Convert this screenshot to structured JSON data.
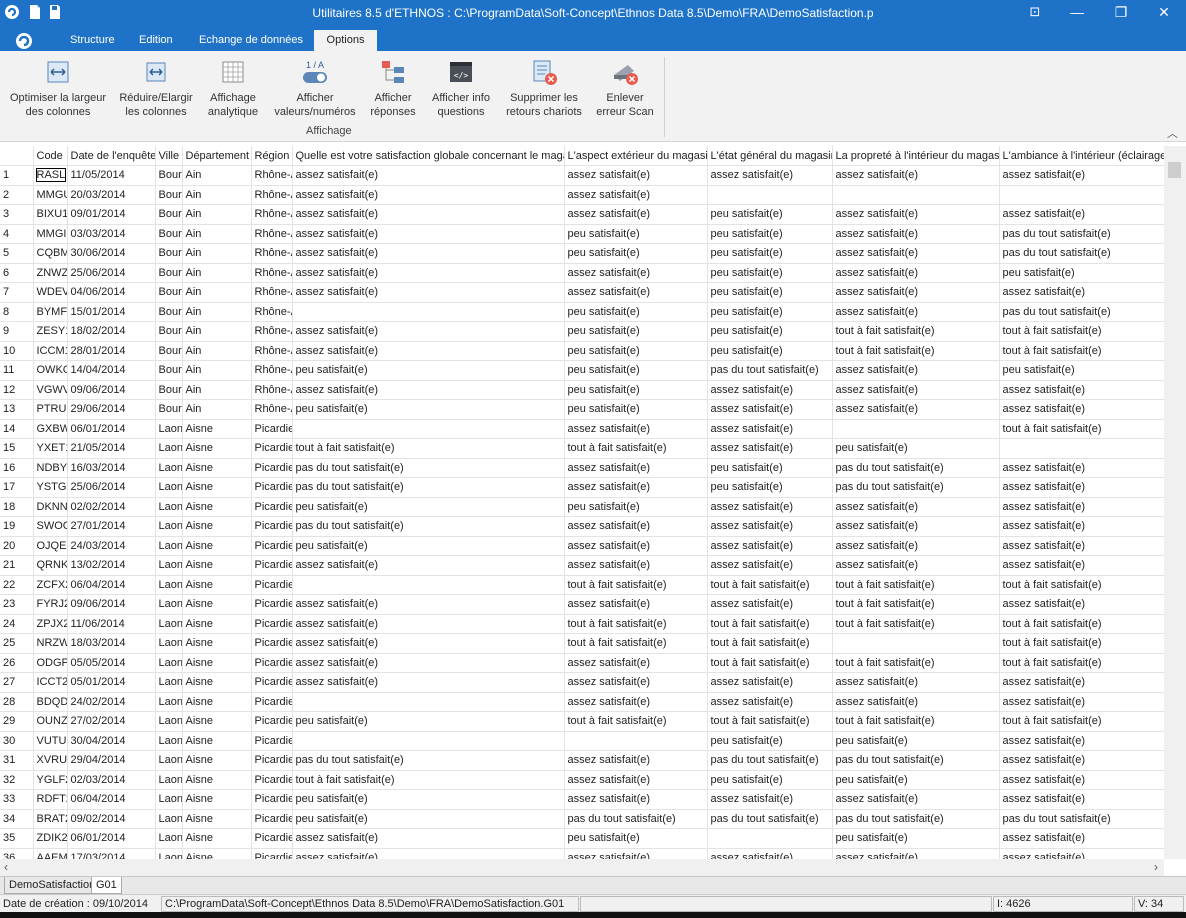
{
  "window": {
    "title": "Utilitaires 8.5 d'ETHNOS : C:\\ProgramData\\Soft-Concept\\Ethnos Data 8.5\\Demo\\FRA\\DemoSatisfaction.p",
    "min": "—",
    "restore": "❐",
    "close": "✕",
    "pin": "⊡"
  },
  "tabs": [
    "Structure",
    "Edition",
    "Echange de données",
    "Options"
  ],
  "ribbon": {
    "buttons": [
      {
        "line1": "Optimiser la largeur",
        "line2": "des colonnes",
        "icon": "fit-width-icon"
      },
      {
        "line1": "Réduire/Elargir",
        "line2": "les colonnes",
        "icon": "resize-columns-icon"
      },
      {
        "line1": "Affichage",
        "line2": "analytique",
        "icon": "grid-icon"
      },
      {
        "line1": "Afficher",
        "line2": "valeurs/numéros",
        "icon": "toggle-values-icon"
      },
      {
        "line1": "Afficher",
        "line2": "réponses",
        "icon": "show-answers-icon"
      },
      {
        "line1": "Afficher info",
        "line2": "questions",
        "icon": "code-icon"
      },
      {
        "line1": "Supprimer les",
        "line2": "retours chariots",
        "icon": "remove-returns-icon"
      },
      {
        "line1": "Enlever",
        "line2": "erreur Scan",
        "icon": "scan-error-icon"
      }
    ],
    "group_label": "Affichage",
    "toggle_label": "1 / A"
  },
  "grid": {
    "headers": [
      "",
      "Code",
      "Date de l'enquête",
      "Ville",
      "Département",
      "Région",
      "Quelle est votre satisfaction globale concernant le magasin",
      "L'aspect extérieur du magasin",
      "L'état général du magasin",
      "La propreté à l'intérieur du magasin",
      "L'ambiance à l'intérieur (éclairage, a"
    ],
    "rows": [
      [
        "1",
        "RASL",
        "11/05/2014",
        "Bourg",
        "Ain",
        "Rhône-A",
        "assez satisfait(e)",
        "assez satisfait(e)",
        "assez satisfait(e)",
        "assez satisfait(e)",
        "assez satisfait(e)"
      ],
      [
        "2",
        "MMGU",
        "20/03/2014",
        "Bourg",
        "Ain",
        "Rhône-A",
        "assez satisfait(e)",
        "assez satisfait(e)",
        "",
        "",
        ""
      ],
      [
        "3",
        "BIXU1",
        "09/01/2014",
        "Bourg",
        "Ain",
        "Rhône-A",
        "assez satisfait(e)",
        "assez satisfait(e)",
        "peu satisfait(e)",
        "assez satisfait(e)",
        "assez satisfait(e)"
      ],
      [
        "4",
        "MMGI1",
        "03/03/2014",
        "Bourg",
        "Ain",
        "Rhône-A",
        "assez satisfait(e)",
        "peu satisfait(e)",
        "peu satisfait(e)",
        "assez satisfait(e)",
        "pas du tout satisfait(e)"
      ],
      [
        "5",
        "CQBM",
        "30/06/2014",
        "Bourg",
        "Ain",
        "Rhône-A",
        "assez satisfait(e)",
        "peu satisfait(e)",
        "peu satisfait(e)",
        "assez satisfait(e)",
        "pas du tout satisfait(e)"
      ],
      [
        "6",
        "ZNWZ",
        "25/06/2014",
        "Bourg",
        "Ain",
        "Rhône-A",
        "assez satisfait(e)",
        "assez satisfait(e)",
        "peu satisfait(e)",
        "assez satisfait(e)",
        "peu satisfait(e)"
      ],
      [
        "7",
        "WDEV",
        "04/06/2014",
        "Bourg",
        "Ain",
        "Rhône-A",
        "assez satisfait(e)",
        "assez satisfait(e)",
        "peu satisfait(e)",
        "assez satisfait(e)",
        "assez satisfait(e)"
      ],
      [
        "8",
        "BYMF1",
        "15/01/2014",
        "Bourg",
        "Ain",
        "Rhône-A",
        "",
        "peu satisfait(e)",
        "peu satisfait(e)",
        "assez satisfait(e)",
        "pas du tout satisfait(e)"
      ],
      [
        "9",
        "ZESY1",
        "18/02/2014",
        "Bourg",
        "Ain",
        "Rhône-A",
        "assez satisfait(e)",
        "peu satisfait(e)",
        "peu satisfait(e)",
        "tout à fait satisfait(e)",
        "tout à fait satisfait(e)"
      ],
      [
        "10",
        "ICCM1",
        "28/01/2014",
        "Bourg",
        "Ain",
        "Rhône-A",
        "assez satisfait(e)",
        "peu satisfait(e)",
        "peu satisfait(e)",
        "tout à fait satisfait(e)",
        "tout à fait satisfait(e)"
      ],
      [
        "11",
        "OWKC",
        "14/04/2014",
        "Bourg",
        "Ain",
        "Rhône-A",
        "peu satisfait(e)",
        "peu satisfait(e)",
        "pas du tout satisfait(e)",
        "assez satisfait(e)",
        "peu satisfait(e)"
      ],
      [
        "12",
        "VGWV",
        "09/06/2014",
        "Bourg",
        "Ain",
        "Rhône-A",
        "assez satisfait(e)",
        "peu satisfait(e)",
        "assez satisfait(e)",
        "assez satisfait(e)",
        "assez satisfait(e)"
      ],
      [
        "13",
        "PTRU1",
        "29/06/2014",
        "Bourg",
        "Ain",
        "Rhône-A",
        "peu satisfait(e)",
        "peu satisfait(e)",
        "assez satisfait(e)",
        "assez satisfait(e)",
        "assez satisfait(e)"
      ],
      [
        "14",
        "GXBW",
        "06/01/2014",
        "Laon",
        "Aisne",
        "Picardie",
        "",
        "assez satisfait(e)",
        "assez satisfait(e)",
        "",
        "tout à fait satisfait(e)"
      ],
      [
        "15",
        "YXET1",
        "21/05/2014",
        "Laon",
        "Aisne",
        "Picardie",
        "tout à fait satisfait(e)",
        "tout à fait satisfait(e)",
        "assez satisfait(e)",
        "peu satisfait(e)",
        ""
      ],
      [
        "16",
        "NDBY1",
        "16/03/2014",
        "Laon",
        "Aisne",
        "Picardie",
        "pas du tout satisfait(e)",
        "assez satisfait(e)",
        "peu satisfait(e)",
        "pas du tout satisfait(e)",
        "assez satisfait(e)"
      ],
      [
        "17",
        "YSTG1",
        "25/06/2014",
        "Laon",
        "Aisne",
        "Picardie",
        "pas du tout satisfait(e)",
        "assez satisfait(e)",
        "peu satisfait(e)",
        "pas du tout satisfait(e)",
        "assez satisfait(e)"
      ],
      [
        "18",
        "DKNN2",
        "02/02/2014",
        "Laon",
        "Aisne",
        "Picardie",
        "peu satisfait(e)",
        "peu satisfait(e)",
        "assez satisfait(e)",
        "assez satisfait(e)",
        "assez satisfait(e)"
      ],
      [
        "19",
        "SWOC",
        "27/01/2014",
        "Laon",
        "Aisne",
        "Picardie",
        "pas du tout satisfait(e)",
        "assez satisfait(e)",
        "assez satisfait(e)",
        "assez satisfait(e)",
        "assez satisfait(e)"
      ],
      [
        "20",
        "OJQE2",
        "24/03/2014",
        "Laon",
        "Aisne",
        "Picardie",
        "peu satisfait(e)",
        "assez satisfait(e)",
        "assez satisfait(e)",
        "assez satisfait(e)",
        "assez satisfait(e)"
      ],
      [
        "21",
        "QRNK2",
        "13/02/2014",
        "Laon",
        "Aisne",
        "Picardie",
        "assez satisfait(e)",
        "assez satisfait(e)",
        "assez satisfait(e)",
        "assez satisfait(e)",
        "assez satisfait(e)"
      ],
      [
        "22",
        "ZCFX2",
        "06/04/2014",
        "Laon",
        "Aisne",
        "Picardie",
        "",
        "tout à fait satisfait(e)",
        "tout à fait satisfait(e)",
        "tout à fait satisfait(e)",
        "tout à fait satisfait(e)"
      ],
      [
        "23",
        "FYRJ2",
        "09/06/2014",
        "Laon",
        "Aisne",
        "Picardie",
        "assez satisfait(e)",
        "assez satisfait(e)",
        "assez satisfait(e)",
        "tout à fait satisfait(e)",
        "assez satisfait(e)"
      ],
      [
        "24",
        "ZPJX2",
        "11/06/2014",
        "Laon",
        "Aisne",
        "Picardie",
        "assez satisfait(e)",
        "tout à fait satisfait(e)",
        "tout à fait satisfait(e)",
        "tout à fait satisfait(e)",
        "tout à fait satisfait(e)"
      ],
      [
        "25",
        "NRZW",
        "18/03/2014",
        "Laon",
        "Aisne",
        "Picardie",
        "assez satisfait(e)",
        "tout à fait satisfait(e)",
        "tout à fait satisfait(e)",
        "",
        "tout à fait satisfait(e)"
      ],
      [
        "26",
        "ODGP2",
        "05/05/2014",
        "Laon",
        "Aisne",
        "Picardie",
        "assez satisfait(e)",
        "assez satisfait(e)",
        "tout à fait satisfait(e)",
        "tout à fait satisfait(e)",
        "tout à fait satisfait(e)"
      ],
      [
        "27",
        "ICCT2",
        "05/01/2014",
        "Laon",
        "Aisne",
        "Picardie",
        "assez satisfait(e)",
        "assez satisfait(e)",
        "assez satisfait(e)",
        "assez satisfait(e)",
        "assez satisfait(e)"
      ],
      [
        "28",
        "BDQD2",
        "24/02/2014",
        "Laon",
        "Aisne",
        "Picardie",
        "",
        "assez satisfait(e)",
        "assez satisfait(e)",
        "assez satisfait(e)",
        "assez satisfait(e)"
      ],
      [
        "29",
        "OUNZ2",
        "27/02/2014",
        "Laon",
        "Aisne",
        "Picardie",
        "peu satisfait(e)",
        "tout à fait satisfait(e)",
        "tout à fait satisfait(e)",
        "tout à fait satisfait(e)",
        "tout à fait satisfait(e)"
      ],
      [
        "30",
        "VUTU2",
        "30/04/2014",
        "Laon",
        "Aisne",
        "Picardie",
        "",
        "",
        "peu satisfait(e)",
        "peu satisfait(e)",
        "assez satisfait(e)"
      ],
      [
        "31",
        "XVRU2",
        "29/04/2014",
        "Laon",
        "Aisne",
        "Picardie",
        "pas du tout satisfait(e)",
        "assez satisfait(e)",
        "pas du tout satisfait(e)",
        "pas du tout satisfait(e)",
        "assez satisfait(e)"
      ],
      [
        "32",
        "YGLF2",
        "02/03/2014",
        "Laon",
        "Aisne",
        "Picardie",
        "tout à fait satisfait(e)",
        "assez satisfait(e)",
        "peu satisfait(e)",
        "peu satisfait(e)",
        "assez satisfait(e)"
      ],
      [
        "33",
        "RDFT2",
        "06/04/2014",
        "Laon",
        "Aisne",
        "Picardie",
        "peu satisfait(e)",
        "assez satisfait(e)",
        "assez satisfait(e)",
        "assez satisfait(e)",
        "assez satisfait(e)"
      ],
      [
        "34",
        "BRAT2",
        "09/02/2014",
        "Laon",
        "Aisne",
        "Picardie",
        "peu satisfait(e)",
        "pas du tout satisfait(e)",
        "pas du tout satisfait(e)",
        "pas du tout satisfait(e)",
        "pas du tout satisfait(e)"
      ],
      [
        "35",
        "ZDIK2",
        "06/01/2014",
        "Laon",
        "Aisne",
        "Picardie",
        "assez satisfait(e)",
        "peu satisfait(e)",
        "",
        "peu satisfait(e)",
        "assez satisfait(e)"
      ],
      [
        "36",
        "AAEM",
        "17/03/2014",
        "Laon",
        "Aisne",
        "Picardie",
        "assez satisfait(e)",
        "assez satisfait(e)",
        "assez satisfait(e)",
        "assez satisfait(e)",
        "assez satisfait(e)"
      ]
    ]
  },
  "sheets": [
    "DemoSatisfaction",
    "G01"
  ],
  "status": {
    "created": "Date de création : 09/10/2014",
    "path": "C:\\ProgramData\\Soft-Concept\\Ethnos Data 8.5\\Demo\\FRA\\DemoSatisfaction.G01",
    "count": "I: 4626",
    "vars": "V: 34"
  },
  "colors": {
    "accent": "#1e73c8",
    "ribbon": "#f2f2f2"
  }
}
